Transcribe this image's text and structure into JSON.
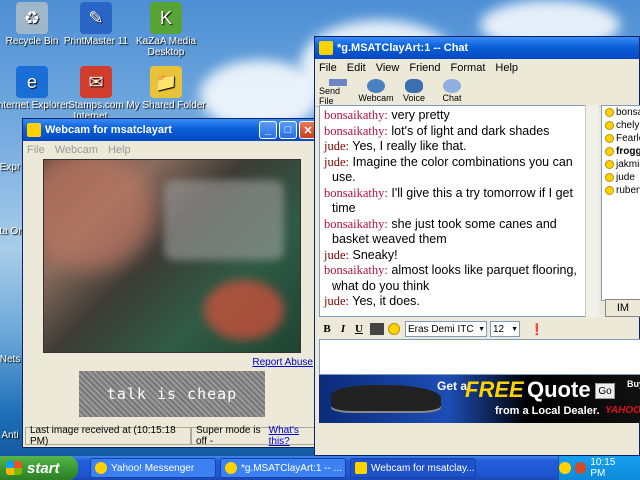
{
  "desktop_icons": [
    {
      "label": "Recycle Bin",
      "icon": "recycle-bin-icon",
      "color": "#9fb7c9"
    },
    {
      "label": "PrintMaster 11",
      "icon": "printmaster-icon",
      "color": "#2a66c8"
    },
    {
      "label": "KaZaA Media Desktop",
      "icon": "kazaa-icon",
      "color": "#58a335"
    },
    {
      "label": "Internet Explorer",
      "icon": "internet-explorer-icon",
      "color": "#1a6fd6"
    },
    {
      "label": "Stamps.com Internet ...",
      "icon": "stamps-icon",
      "color": "#d23c2c"
    },
    {
      "label": "My Shared Folder",
      "icon": "shared-folder-icon",
      "color": "#e8c33a"
    }
  ],
  "desktop_partial_labels": [
    "Expr",
    "Insta Onlin",
    "Nets",
    "Anti"
  ],
  "webcam_window": {
    "title": "Webcam for msatclayart",
    "menu": [
      "File",
      "Webcam",
      "Help"
    ],
    "report_abuse": "Report Abuse",
    "banner_text": "talk is cheap",
    "status_last_image": "Last image received at (10:15:18 PM)",
    "status_super_mode": "Super mode is off - ",
    "status_whats_this": "What's this?"
  },
  "chat_window": {
    "title": "*g.MSATClayArt:1 -- Chat",
    "menu": [
      "File",
      "Edit",
      "View",
      "Friend",
      "Format",
      "Help"
    ],
    "toolbar": [
      {
        "label": "Send File",
        "icon": "send-file-icon"
      },
      {
        "label": "Webcam",
        "icon": "webcam-icon"
      },
      {
        "label": "Voice",
        "icon": "voice-icon"
      },
      {
        "label": "Chat",
        "icon": "chat-icon"
      }
    ],
    "messages": [
      {
        "sender": "bonsaikathy:",
        "text": "very pretty"
      },
      {
        "sender": "bonsaikathy:",
        "text": "lot's of light and dark shades"
      },
      {
        "sender": "jude:",
        "text": "Yes, I really like that."
      },
      {
        "sender": "jude:",
        "text": "Imagine the color combinations you can use."
      },
      {
        "sender": "bonsaikathy:",
        "text": "I'll give this a try tomorrow if I get time"
      },
      {
        "sender": "bonsaikathy:",
        "text": "she just took some canes and basket weaved them"
      },
      {
        "sender": "jude:",
        "text": "Sneaky!"
      },
      {
        "sender": "bonsaikathy:",
        "text": "almost looks like parquet flooring, what do you think"
      },
      {
        "sender": "jude:",
        "text": "Yes, it does."
      }
    ],
    "buddies": [
      "bonsa",
      "chelyh",
      "Fearle",
      "frogg",
      "jakmia",
      "jude",
      "rubens"
    ],
    "im_button": "IM",
    "format": {
      "bold": "B",
      "italic": "I",
      "underline": "U",
      "font": "Eras Demi ITC",
      "size": "12"
    },
    "ad": {
      "get_a": "Get a",
      "free": "FREE",
      "quote": "Quote",
      "dealer": "from a Local Dealer.",
      "go": "Go",
      "buy": "Buy",
      "brand": "YAHOO"
    }
  },
  "taskbar": {
    "start": "start",
    "tasks": [
      "Yahoo! Messenger",
      "*g.MSATClayArt:1 -- ...",
      "Webcam for msatclay..."
    ],
    "clock": "10:15 PM"
  },
  "colors": {
    "sender_other": "#b0103c",
    "sender_self": "#7a0000",
    "titlebar": "#0a5fd8",
    "taskbar": "#245edb"
  }
}
